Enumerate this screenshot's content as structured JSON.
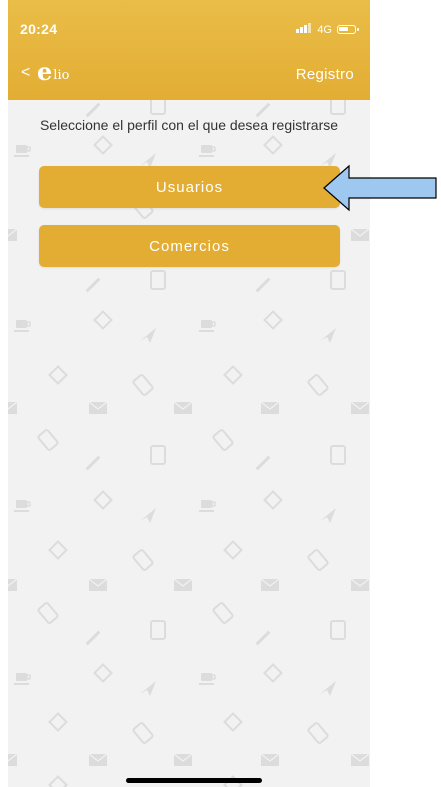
{
  "status_bar": {
    "time": "20:24",
    "network": "4G",
    "signal_icon": "signal-bars-icon",
    "battery_icon": "battery-icon"
  },
  "header": {
    "back_icon": "chevron-left-icon",
    "back_glyph": "<",
    "logo_mark": "e",
    "logo_text": "lio",
    "title": "Registro"
  },
  "main": {
    "prompt": "Seleccione el perfil con el que desea registrarse",
    "buttons": [
      {
        "label": "Usuarios"
      },
      {
        "label": "Comercios"
      }
    ]
  },
  "annotation": {
    "arrow_icon": "left-arrow-icon",
    "arrow_color": "#9ec8f0"
  },
  "colors": {
    "brand": "#e3ad33",
    "header_top": "#e9bd48",
    "background": "#f2f2f2",
    "text": "#333333",
    "pattern_icons": "#dddddd"
  }
}
